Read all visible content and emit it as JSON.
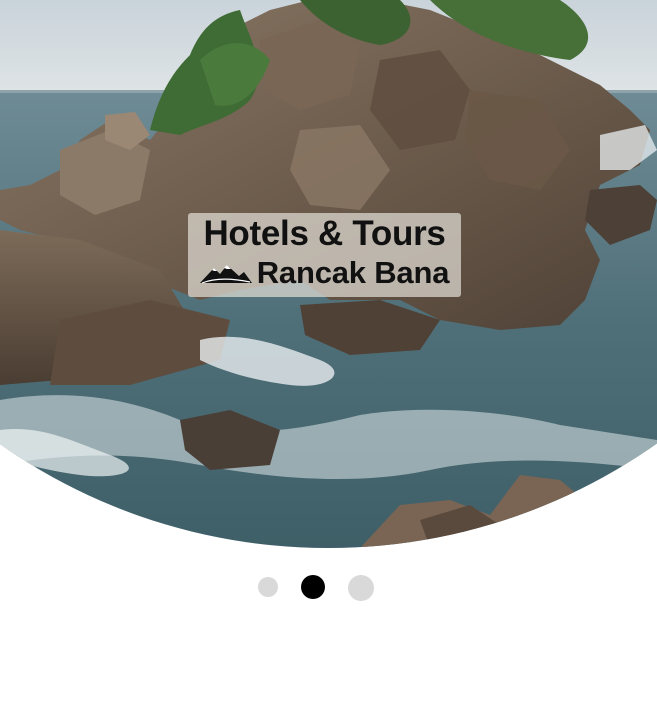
{
  "hero": {
    "image_icon": "coastal-rocks-photo",
    "logo": {
      "title": "Hotels & Tours",
      "icon": "mountain-icon",
      "brand": "Rancak Bana"
    }
  },
  "pagination": {
    "total": 3,
    "active_index": 1
  },
  "colors": {
    "active_dot": "#000000",
    "inactive_dot": "#d9d9d9",
    "logo_text": "#111111"
  }
}
